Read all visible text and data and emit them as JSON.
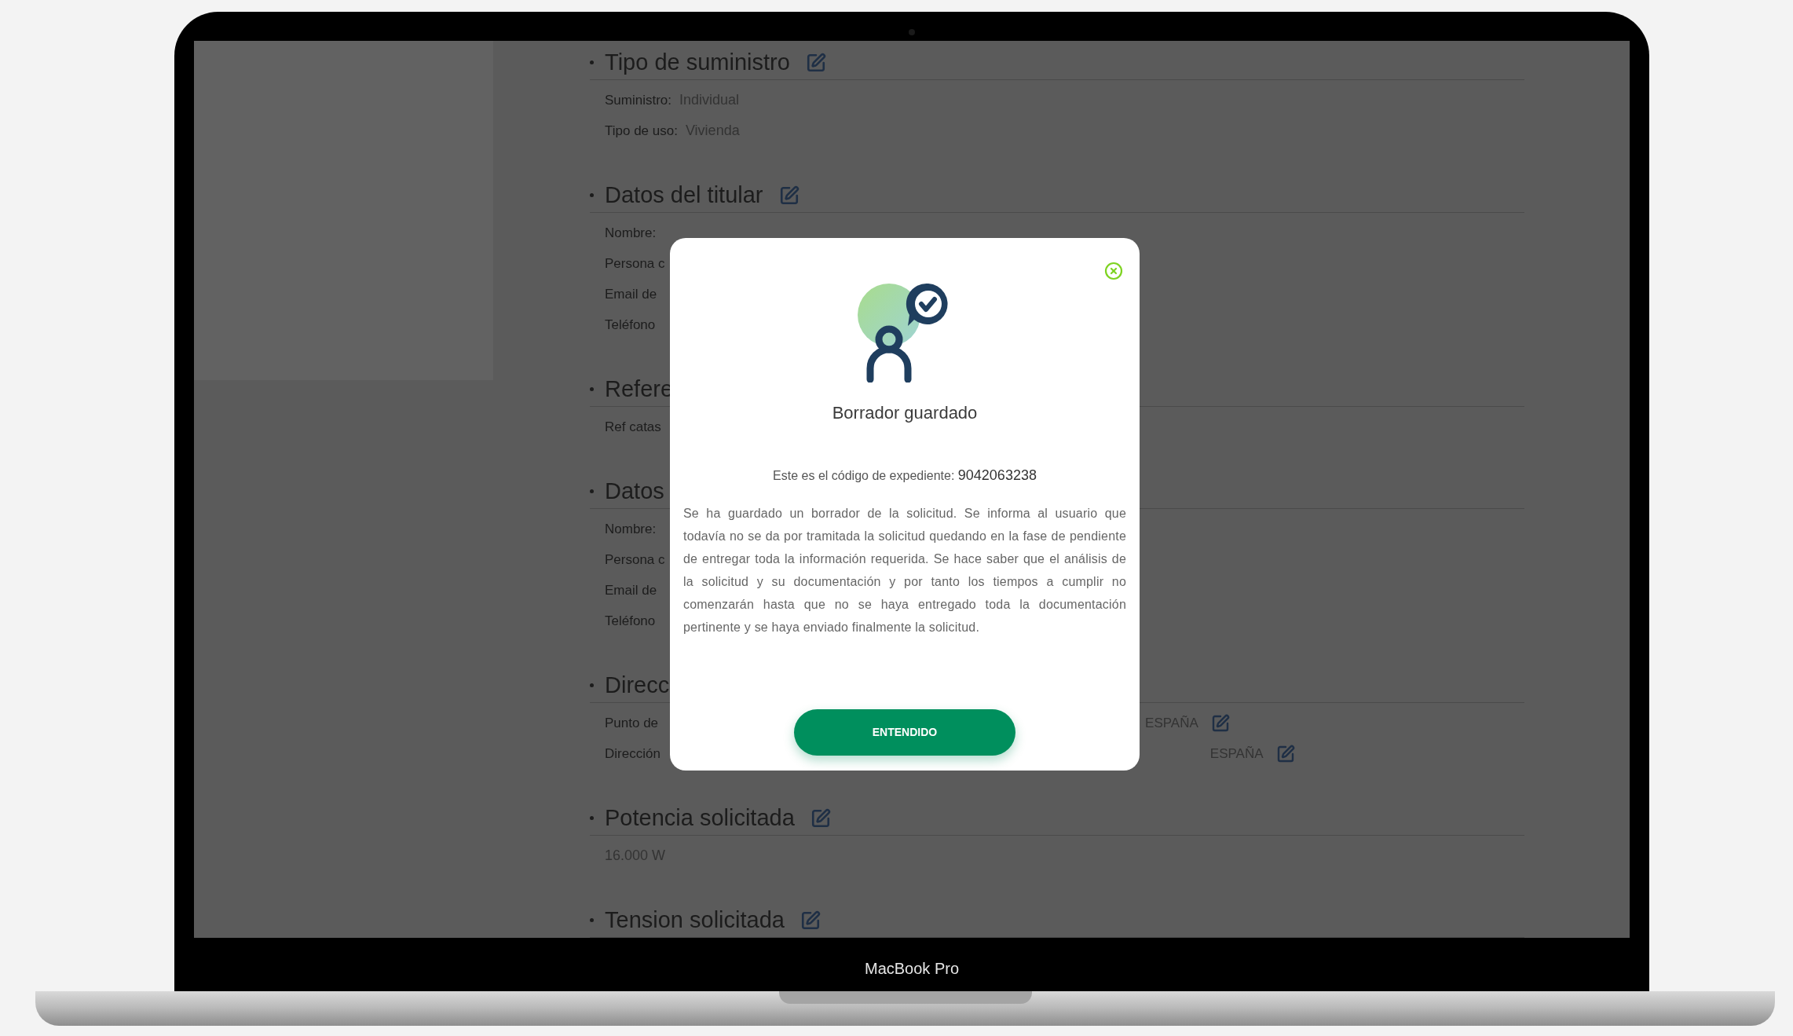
{
  "laptop": {
    "label": "MacBook Pro"
  },
  "sections": [
    {
      "heading": "Tipo de suministro",
      "edit_icon": true,
      "rows": [
        {
          "label": "Suministro:",
          "value": "Individual"
        },
        {
          "label": "Tipo de uso:",
          "value": "Vivienda"
        }
      ]
    },
    {
      "heading": "Datos del titular",
      "edit_icon": true,
      "rows": [
        {
          "label": "Nombre:"
        },
        {
          "label": "Persona c"
        },
        {
          "label": "Email de"
        },
        {
          "label": "Teléfono"
        }
      ]
    },
    {
      "heading": "Refere",
      "edit_icon": false,
      "rows": [
        {
          "label": "Ref catas"
        }
      ]
    },
    {
      "heading": "Datos",
      "edit_icon": false,
      "rows": [
        {
          "label": "Nombre:"
        },
        {
          "label": "Persona c"
        },
        {
          "label": "Email de"
        },
        {
          "label": "Teléfono"
        }
      ]
    },
    {
      "heading": "Direcc",
      "edit_icon": false,
      "rows": [
        {
          "label": "Punto de",
          "extra": "ESPAÑA"
        },
        {
          "label": "Dirección",
          "extra": "ESPAÑA"
        }
      ]
    },
    {
      "heading": "Potencia solicitada",
      "edit_icon": true,
      "rows": [
        {
          "value": "16.000 W"
        }
      ]
    },
    {
      "heading": "Tension solicitada",
      "edit_icon": true
    }
  ],
  "modal": {
    "title": "Borrador guardado",
    "code_label": "Este es el código de expediente:",
    "code": "9042063238",
    "message": "Se ha guardado un borrador de la solicitud. Se informa al usuario que todavía no se da por tramitada la solicitud quedando en la fase de pendiente de entregar toda la información requerida. Se hace saber que el análisis de la solicitud y su documentación y por tanto los tiempos a cumplir no comenzarán hasta que no se haya entregado toda la documentación pertinente y se haya enviado finalmente la solicitud.",
    "button": "ENTENDIDO"
  }
}
